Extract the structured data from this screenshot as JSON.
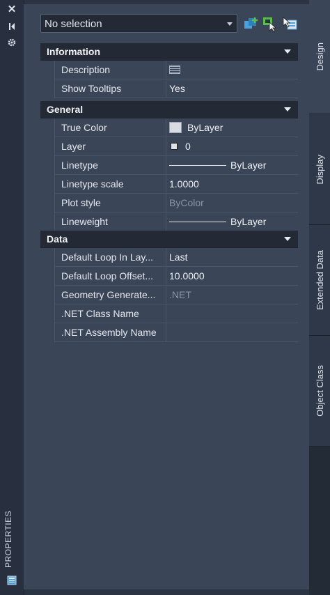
{
  "toolbar": {
    "selection_value": "No selection",
    "buttons": [
      "quick-select-icon",
      "select-objects-icon",
      "toggle-pickadd-icon"
    ]
  },
  "left_strip": {
    "label": "PROPERTIES",
    "icons": [
      "close-icon",
      "autohide-icon",
      "settings-icon",
      "properties-panel-icon"
    ]
  },
  "sections": {
    "information": {
      "title": "Information",
      "rows": [
        {
          "name": "Description",
          "value": ""
        },
        {
          "name": "Show Tooltips",
          "value": "Yes"
        }
      ]
    },
    "general": {
      "title": "General",
      "rows": [
        {
          "name": "True Color",
          "value": "ByLayer"
        },
        {
          "name": "Layer",
          "value": "0"
        },
        {
          "name": "Linetype",
          "value": "ByLayer"
        },
        {
          "name": "Linetype scale",
          "value": "1.0000"
        },
        {
          "name": "Plot style",
          "value": "ByColor"
        },
        {
          "name": "Lineweight",
          "value": "ByLayer"
        }
      ]
    },
    "data": {
      "title": "Data",
      "rows": [
        {
          "name": "Default Loop In Lay...",
          "value": "Last"
        },
        {
          "name": "Default Loop Offset...",
          "value": "10.0000"
        },
        {
          "name": "Geometry  Generate...",
          "value": ".NET"
        },
        {
          "name": ".NET Class Name",
          "value": ""
        },
        {
          "name": ".NET Assembly Name",
          "value": ""
        }
      ]
    }
  },
  "tabs": [
    {
      "label": "Design",
      "active": true
    },
    {
      "label": "Display",
      "active": false
    },
    {
      "label": "Extended Data",
      "active": false
    },
    {
      "label": "Object Class",
      "active": false
    }
  ],
  "colors": {
    "panel_bg": "#3a4557",
    "header_bg": "#232a35",
    "accent_blue": "#4aa3df",
    "accent_green": "#58c04a"
  }
}
